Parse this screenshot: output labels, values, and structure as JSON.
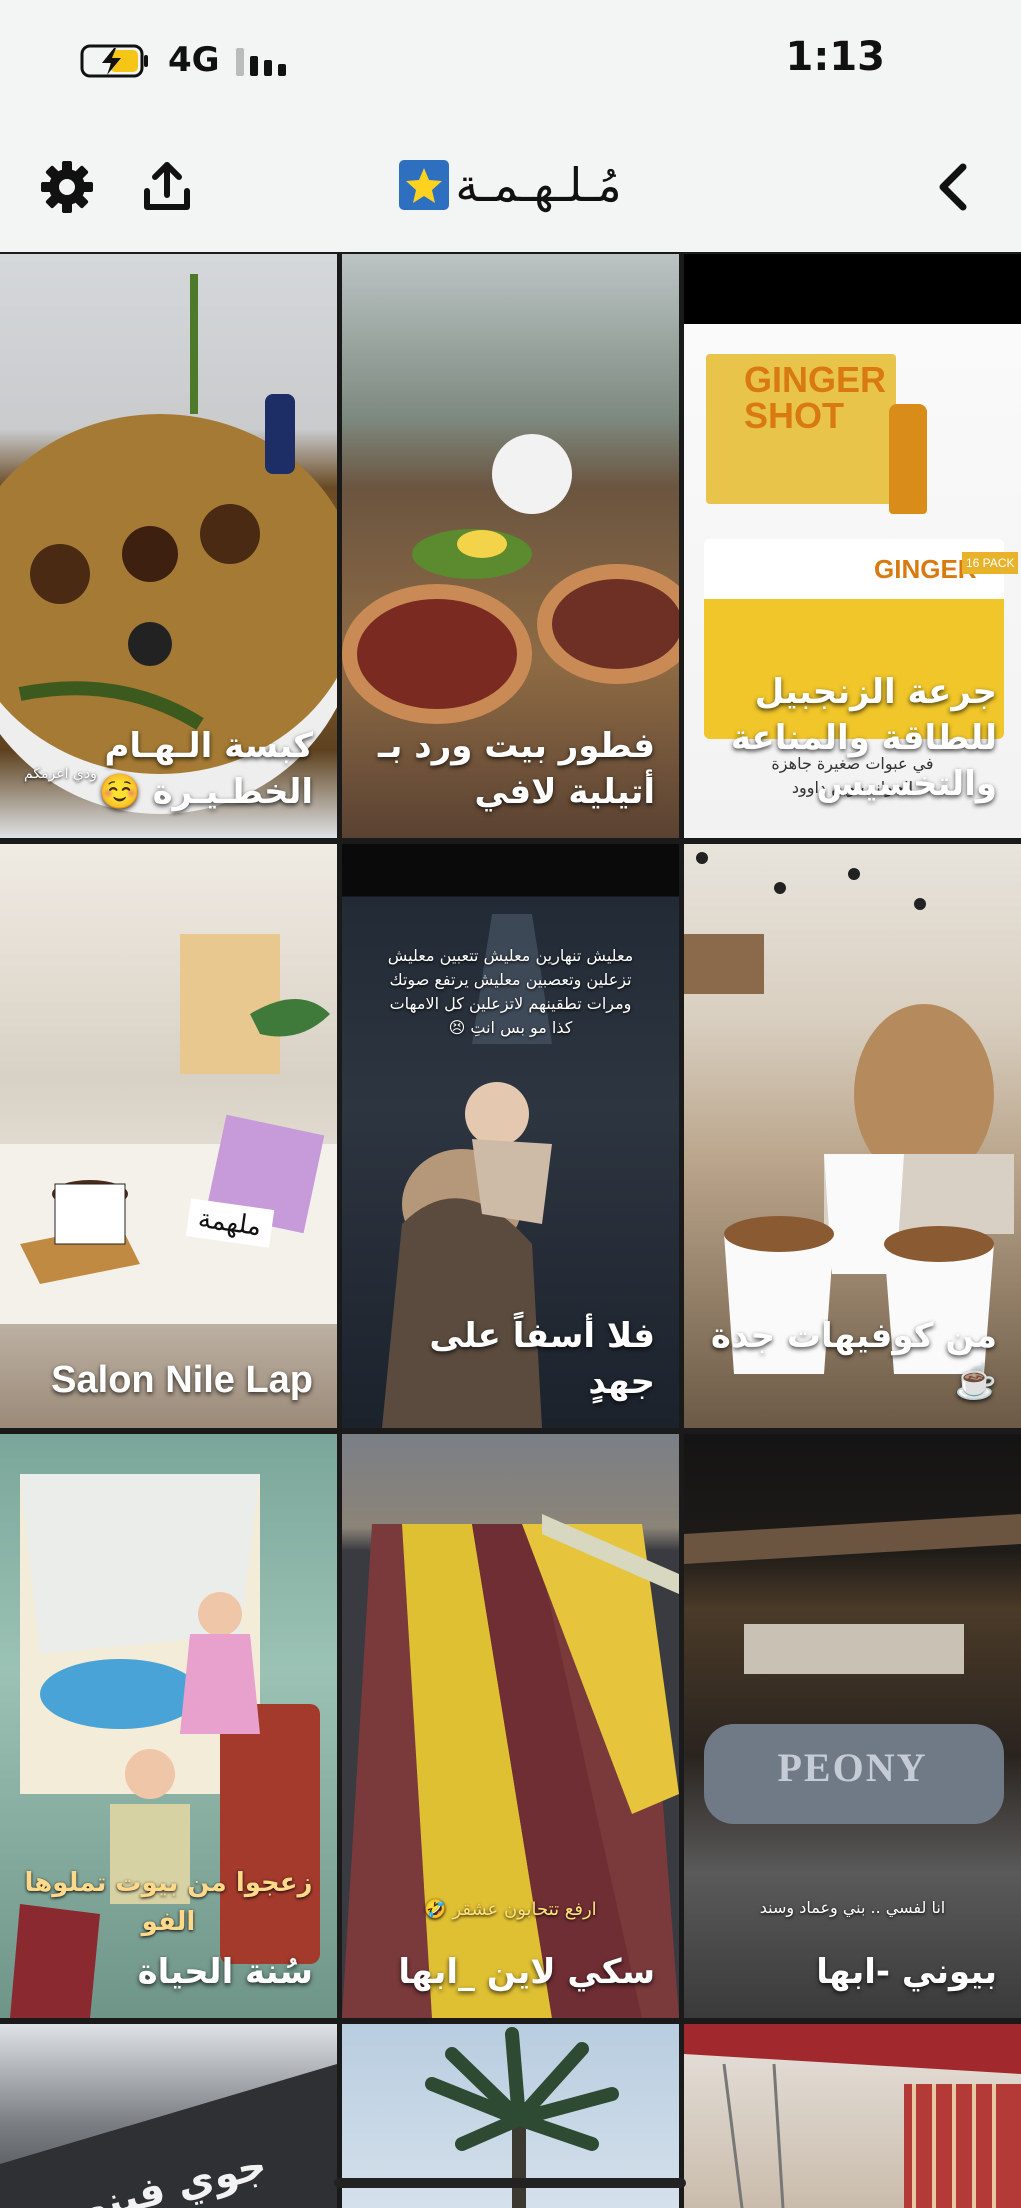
{
  "status": {
    "network": "4G",
    "time": "1:13"
  },
  "header": {
    "title": "مُـلـهـمـة",
    "title_emoji": "star-icon",
    "settings_icon": "gear-icon",
    "share_icon": "share-icon",
    "back_icon": "chevron-left-icon"
  },
  "tiles": [
    {
      "caption": "كبسة الـهـام\nالخطـيـرة ☺️",
      "overlay": "ودي اعزمكم"
    },
    {
      "caption": "فطور بيت ورد بـ\nأتيلية لافي"
    },
    {
      "caption": "جرعة الزنجبيل\nللطاقة والمناعة\nوالتخسيس",
      "product_title": "GINGER\nSHOT",
      "product_badge": "16 PACK",
      "overlay": "في عبوات صغيرة جاهزة\nالجوانب وين داوود"
    },
    {
      "caption": "Salon Nile Lap",
      "cafe_sign": "ملهمة"
    },
    {
      "caption": "فلا أسفاً على جهدٍ",
      "overlay": "معليش تنهارين معليش تتعبين معليش تزعلين وتعصبين معليش يرتفع صوتك ومرات تطقينهم لاتزعلين كل الامهات كذا مو بس انتِ 😣"
    },
    {
      "caption": "من كوفيهات جدة ☕️"
    },
    {
      "caption": "سُنة الحياة",
      "overlay": "زعجوا من بيوت تملوها الفو"
    },
    {
      "caption": "سكي لاين _ابها",
      "overlay": "ارفع تتحابون عشقر 🤣"
    },
    {
      "caption": "بيوني -ابها",
      "sign": "PEONY",
      "overlay": "انا لفسي .. بني وعماد وسند"
    },
    {
      "caption": "جوي فينو"
    },
    {
      "caption": ""
    },
    {
      "caption": ""
    }
  ]
}
